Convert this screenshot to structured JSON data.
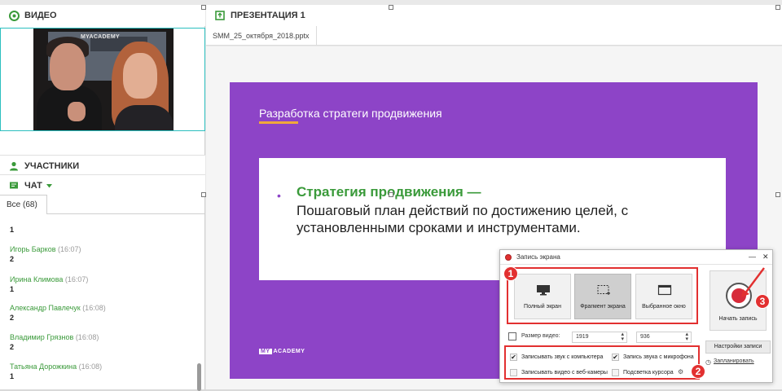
{
  "left": {
    "video_title": "ВИДЕО",
    "video_wall_text": "MYACADEMY",
    "participants_title": "УЧАСТНИКИ",
    "chat_title": "ЧАТ",
    "chat_tab": "Все (68)",
    "chat_messages": [
      {
        "author": "",
        "time": "",
        "text": "1"
      },
      {
        "author": "Игорь Барков",
        "time": "(16:07)",
        "text": "2"
      },
      {
        "author": "Ирина Климова",
        "time": "(16:07)",
        "text": "1"
      },
      {
        "author": "Александр Павлечук",
        "time": "(16:08)",
        "text": "2"
      },
      {
        "author": "Владимир Грязнов",
        "time": "(16:08)",
        "text": "2"
      },
      {
        "author": "Татьяна Дорожкина",
        "time": "(16:08)",
        "text": "1"
      }
    ]
  },
  "presentation": {
    "title": "ПРЕЗЕНТАЦИЯ 1",
    "file_tab": "SMM_25_октября_2018.pptx",
    "slide": {
      "title": "Разработка стратеги продвижения",
      "card_head": "Стратегия продвижения —",
      "card_body": "Пошаговый план действий по достижению целей, с установленными сроками и инструментами.",
      "logo": "ACADEMY",
      "logo_prefix": "MY"
    }
  },
  "recorder": {
    "title": "Запись экрана",
    "minimize": "—",
    "close": "✕",
    "modes": [
      {
        "label": "Полный экран",
        "icon": "monitor-icon"
      },
      {
        "label": "Фрагмент экрана",
        "icon": "crop-icon"
      },
      {
        "label": "Выбранное окно",
        "icon": "window-icon"
      }
    ],
    "start_label": "Начать запись",
    "size_label": "Размер видео:",
    "width": "1919",
    "height": "936",
    "settings_label": "Настройки записи",
    "plan_label": "Запланировать",
    "options": [
      {
        "label": "Записывать звук с компьютера",
        "checked": true
      },
      {
        "label": "Запись звука с микрофона",
        "checked": true
      },
      {
        "label": "Записывать видео с веб-камеры",
        "checked": false
      },
      {
        "label": "Подсветка курсора",
        "checked": false
      }
    ],
    "badges": [
      "1",
      "2",
      "3"
    ]
  },
  "colors": {
    "accent_green": "#3a9a3a",
    "slide_purple": "#8d44c7",
    "highlight_red": "#e23030"
  }
}
